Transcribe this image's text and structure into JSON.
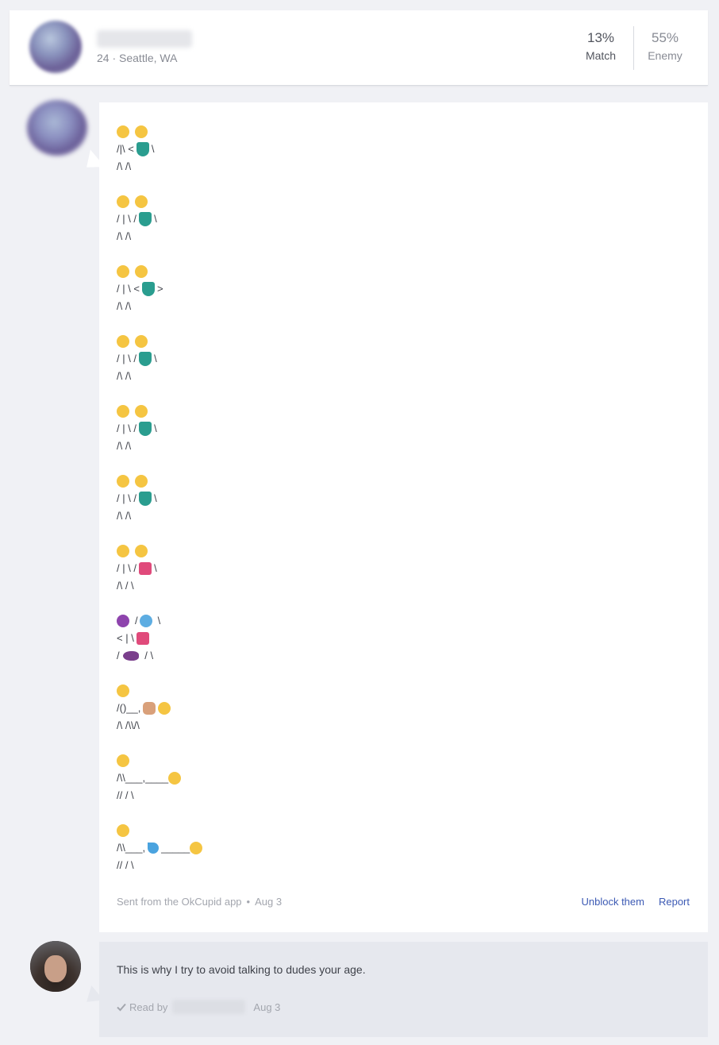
{
  "header": {
    "location": "24 · Seattle, WA",
    "match_pct": "13%",
    "match_label": "Match",
    "enemy_pct": "55%",
    "enemy_label": "Enemy"
  },
  "message1": {
    "stanzas": [
      {
        "faces": [
          "#f5c542",
          "#f5c542"
        ],
        "lines": [
          [
            "/|\\ <",
            "dress",
            "\\"
          ],
          [
            "/\\ /\\"
          ]
        ]
      },
      {
        "faces": [
          "#f5c542",
          "#f5c542"
        ],
        "lines": [
          [
            "/ | \\ /",
            "dress",
            "\\"
          ],
          [
            "/\\ /\\"
          ]
        ]
      },
      {
        "faces": [
          "#f5c542",
          "#f5c542"
        ],
        "lines": [
          [
            "/ | \\ <",
            "dress",
            ">"
          ],
          [
            "/\\ /\\"
          ]
        ]
      },
      {
        "faces": [
          "#f5c542",
          "#f5c542"
        ],
        "lines": [
          [
            "/ | \\ /",
            "dress",
            "\\"
          ],
          [
            "/\\ /\\"
          ]
        ]
      },
      {
        "faces": [
          "#f5c542",
          "#f5c542"
        ],
        "lines": [
          [
            "/ | \\ /",
            "dress",
            "\\"
          ],
          [
            "/\\ /\\"
          ]
        ]
      },
      {
        "faces": [
          "#f5c542",
          "#f5c542"
        ],
        "lines": [
          [
            "/ | \\ /",
            "dress",
            "\\"
          ],
          [
            "/\\ /\\"
          ]
        ]
      },
      {
        "faces": [
          "#f5c542",
          "#f5c542"
        ],
        "lines": [
          [
            "/ | \\ /",
            "bikini",
            "\\"
          ],
          [
            "/\\ / \\"
          ]
        ]
      },
      {
        "faces": [
          "#8e44ad",
          "#5dade2"
        ],
        "face_line": [
          "devil",
          "/",
          "fear",
          "\\"
        ],
        "lines": [
          [
            "< | \\",
            "bikini",
            ""
          ],
          [
            "/",
            "eggplant",
            " / \\"
          ]
        ]
      },
      {
        "faces": [
          "#f5c542"
        ],
        "lines": [
          [
            "/()__,",
            "fist",
            "",
            "face"
          ],
          [
            "/\\ /\\\\/\\"
          ]
        ]
      },
      {
        "faces": [
          "#f5c542"
        ],
        "lines": [
          [
            "/\\\\___,____",
            "face"
          ],
          [
            "// / \\"
          ]
        ]
      },
      {
        "faces": [
          "#f5c542"
        ],
        "lines": [
          [
            "/\\\\___,",
            "drops",
            "_____",
            "face"
          ],
          [
            "// / \\"
          ]
        ]
      }
    ],
    "sent_from": "Sent from the OkCupid app",
    "date": "Aug 3",
    "unblock_label": "Unblock them",
    "report_label": "Report"
  },
  "message2": {
    "text": "This is why I try to avoid talking to dudes your age.",
    "read_by": "Read by",
    "date": "Aug 3"
  },
  "colors": {
    "link": "#3c5ab4",
    "emoji_yellow": "#f5c542"
  }
}
